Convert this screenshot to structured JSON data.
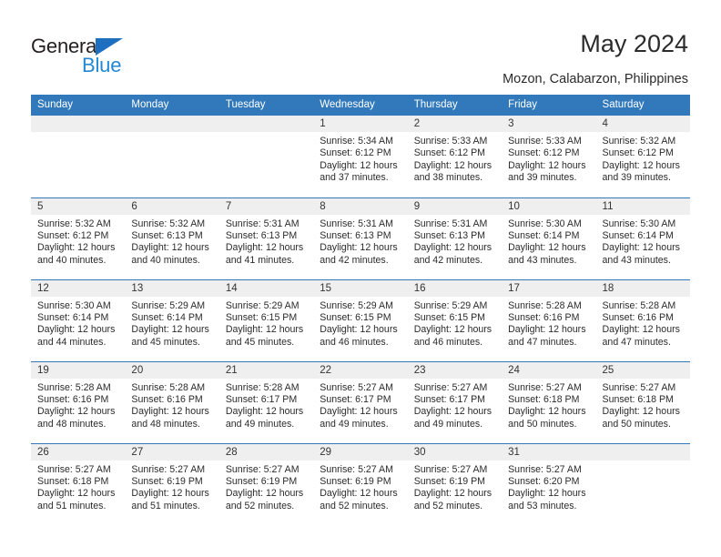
{
  "logo": {
    "text_primary": "General",
    "text_secondary": "Blue",
    "color_primary": "#231f20",
    "color_secondary": "#2288d6",
    "triangle_color": "#1f6fc0"
  },
  "header": {
    "title": "May 2024",
    "subtitle": "Mozon, Calabarzon, Philippines"
  },
  "theme": {
    "header_bg": "#3279bc",
    "header_text": "#ffffff",
    "daynum_bg": "#efefef",
    "grid_line": "#3279bc"
  },
  "calendar": {
    "weekday_headers": [
      "Sunday",
      "Monday",
      "Tuesday",
      "Wednesday",
      "Thursday",
      "Friday",
      "Saturday"
    ],
    "labels": {
      "sunrise": "Sunrise:",
      "sunset": "Sunset:",
      "daylight": "Daylight:"
    },
    "weeks": [
      [
        {
          "day": "",
          "line1": "",
          "line2": "",
          "line3": "",
          "line4": ""
        },
        {
          "day": "",
          "line1": "",
          "line2": "",
          "line3": "",
          "line4": ""
        },
        {
          "day": "",
          "line1": "",
          "line2": "",
          "line3": "",
          "line4": ""
        },
        {
          "day": "1",
          "line1": "Sunrise: 5:34 AM",
          "line2": "Sunset: 6:12 PM",
          "line3": "Daylight: 12 hours",
          "line4": "and 37 minutes."
        },
        {
          "day": "2",
          "line1": "Sunrise: 5:33 AM",
          "line2": "Sunset: 6:12 PM",
          "line3": "Daylight: 12 hours",
          "line4": "and 38 minutes."
        },
        {
          "day": "3",
          "line1": "Sunrise: 5:33 AM",
          "line2": "Sunset: 6:12 PM",
          "line3": "Daylight: 12 hours",
          "line4": "and 39 minutes."
        },
        {
          "day": "4",
          "line1": "Sunrise: 5:32 AM",
          "line2": "Sunset: 6:12 PM",
          "line3": "Daylight: 12 hours",
          "line4": "and 39 minutes."
        }
      ],
      [
        {
          "day": "5",
          "line1": "Sunrise: 5:32 AM",
          "line2": "Sunset: 6:12 PM",
          "line3": "Daylight: 12 hours",
          "line4": "and 40 minutes."
        },
        {
          "day": "6",
          "line1": "Sunrise: 5:32 AM",
          "line2": "Sunset: 6:13 PM",
          "line3": "Daylight: 12 hours",
          "line4": "and 40 minutes."
        },
        {
          "day": "7",
          "line1": "Sunrise: 5:31 AM",
          "line2": "Sunset: 6:13 PM",
          "line3": "Daylight: 12 hours",
          "line4": "and 41 minutes."
        },
        {
          "day": "8",
          "line1": "Sunrise: 5:31 AM",
          "line2": "Sunset: 6:13 PM",
          "line3": "Daylight: 12 hours",
          "line4": "and 42 minutes."
        },
        {
          "day": "9",
          "line1": "Sunrise: 5:31 AM",
          "line2": "Sunset: 6:13 PM",
          "line3": "Daylight: 12 hours",
          "line4": "and 42 minutes."
        },
        {
          "day": "10",
          "line1": "Sunrise: 5:30 AM",
          "line2": "Sunset: 6:14 PM",
          "line3": "Daylight: 12 hours",
          "line4": "and 43 minutes."
        },
        {
          "day": "11",
          "line1": "Sunrise: 5:30 AM",
          "line2": "Sunset: 6:14 PM",
          "line3": "Daylight: 12 hours",
          "line4": "and 43 minutes."
        }
      ],
      [
        {
          "day": "12",
          "line1": "Sunrise: 5:30 AM",
          "line2": "Sunset: 6:14 PM",
          "line3": "Daylight: 12 hours",
          "line4": "and 44 minutes."
        },
        {
          "day": "13",
          "line1": "Sunrise: 5:29 AM",
          "line2": "Sunset: 6:14 PM",
          "line3": "Daylight: 12 hours",
          "line4": "and 45 minutes."
        },
        {
          "day": "14",
          "line1": "Sunrise: 5:29 AM",
          "line2": "Sunset: 6:15 PM",
          "line3": "Daylight: 12 hours",
          "line4": "and 45 minutes."
        },
        {
          "day": "15",
          "line1": "Sunrise: 5:29 AM",
          "line2": "Sunset: 6:15 PM",
          "line3": "Daylight: 12 hours",
          "line4": "and 46 minutes."
        },
        {
          "day": "16",
          "line1": "Sunrise: 5:29 AM",
          "line2": "Sunset: 6:15 PM",
          "line3": "Daylight: 12 hours",
          "line4": "and 46 minutes."
        },
        {
          "day": "17",
          "line1": "Sunrise: 5:28 AM",
          "line2": "Sunset: 6:16 PM",
          "line3": "Daylight: 12 hours",
          "line4": "and 47 minutes."
        },
        {
          "day": "18",
          "line1": "Sunrise: 5:28 AM",
          "line2": "Sunset: 6:16 PM",
          "line3": "Daylight: 12 hours",
          "line4": "and 47 minutes."
        }
      ],
      [
        {
          "day": "19",
          "line1": "Sunrise: 5:28 AM",
          "line2": "Sunset: 6:16 PM",
          "line3": "Daylight: 12 hours",
          "line4": "and 48 minutes."
        },
        {
          "day": "20",
          "line1": "Sunrise: 5:28 AM",
          "line2": "Sunset: 6:16 PM",
          "line3": "Daylight: 12 hours",
          "line4": "and 48 minutes."
        },
        {
          "day": "21",
          "line1": "Sunrise: 5:28 AM",
          "line2": "Sunset: 6:17 PM",
          "line3": "Daylight: 12 hours",
          "line4": "and 49 minutes."
        },
        {
          "day": "22",
          "line1": "Sunrise: 5:27 AM",
          "line2": "Sunset: 6:17 PM",
          "line3": "Daylight: 12 hours",
          "line4": "and 49 minutes."
        },
        {
          "day": "23",
          "line1": "Sunrise: 5:27 AM",
          "line2": "Sunset: 6:17 PM",
          "line3": "Daylight: 12 hours",
          "line4": "and 49 minutes."
        },
        {
          "day": "24",
          "line1": "Sunrise: 5:27 AM",
          "line2": "Sunset: 6:18 PM",
          "line3": "Daylight: 12 hours",
          "line4": "and 50 minutes."
        },
        {
          "day": "25",
          "line1": "Sunrise: 5:27 AM",
          "line2": "Sunset: 6:18 PM",
          "line3": "Daylight: 12 hours",
          "line4": "and 50 minutes."
        }
      ],
      [
        {
          "day": "26",
          "line1": "Sunrise: 5:27 AM",
          "line2": "Sunset: 6:18 PM",
          "line3": "Daylight: 12 hours",
          "line4": "and 51 minutes."
        },
        {
          "day": "27",
          "line1": "Sunrise: 5:27 AM",
          "line2": "Sunset: 6:19 PM",
          "line3": "Daylight: 12 hours",
          "line4": "and 51 minutes."
        },
        {
          "day": "28",
          "line1": "Sunrise: 5:27 AM",
          "line2": "Sunset: 6:19 PM",
          "line3": "Daylight: 12 hours",
          "line4": "and 52 minutes."
        },
        {
          "day": "29",
          "line1": "Sunrise: 5:27 AM",
          "line2": "Sunset: 6:19 PM",
          "line3": "Daylight: 12 hours",
          "line4": "and 52 minutes."
        },
        {
          "day": "30",
          "line1": "Sunrise: 5:27 AM",
          "line2": "Sunset: 6:19 PM",
          "line3": "Daylight: 12 hours",
          "line4": "and 52 minutes."
        },
        {
          "day": "31",
          "line1": "Sunrise: 5:27 AM",
          "line2": "Sunset: 6:20 PM",
          "line3": "Daylight: 12 hours",
          "line4": "and 53 minutes."
        },
        {
          "day": "",
          "line1": "",
          "line2": "",
          "line3": "",
          "line4": ""
        }
      ]
    ]
  }
}
